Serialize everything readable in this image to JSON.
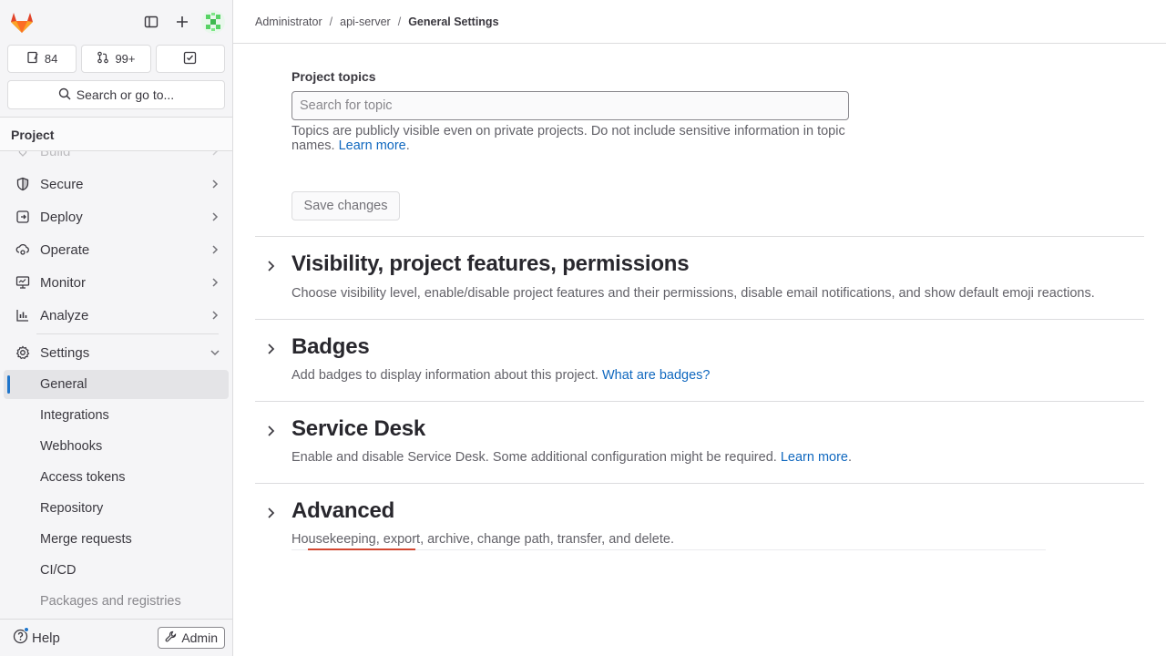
{
  "sidebar": {
    "counts": {
      "issues": "84",
      "merge_requests": "99+"
    },
    "search_label": "Search or go to...",
    "context_label": "Project",
    "nav": [
      {
        "label": "Build",
        "icon": "rocket-icon"
      },
      {
        "label": "Secure",
        "icon": "shield-icon"
      },
      {
        "label": "Deploy",
        "icon": "deploy-icon"
      },
      {
        "label": "Operate",
        "icon": "cloud-gear-icon"
      },
      {
        "label": "Monitor",
        "icon": "monitor-icon"
      },
      {
        "label": "Analyze",
        "icon": "chart-icon"
      },
      {
        "label": "Settings",
        "icon": "gear-icon"
      }
    ],
    "settings_items": [
      "General",
      "Integrations",
      "Webhooks",
      "Access tokens",
      "Repository",
      "Merge requests",
      "CI/CD",
      "Packages and registries"
    ],
    "help_label": "Help",
    "admin_label": "Admin"
  },
  "breadcrumb": {
    "items": [
      "Administrator",
      "api-server"
    ],
    "current": "General Settings"
  },
  "topics": {
    "label": "Project topics",
    "placeholder": "Search for topic",
    "help": "Topics are publicly visible even on private projects. Do not include sensitive information in topic names.",
    "help_link": "Learn more",
    "save_label": "Save changes"
  },
  "sections": [
    {
      "title": "Visibility, project features, permissions",
      "desc": "Choose visibility level, enable/disable project features and their permissions, disable email notifications, and show default emoji reactions.",
      "link": ""
    },
    {
      "title": "Badges",
      "desc": "Add badges to display information about this project.",
      "link": "What are badges?"
    },
    {
      "title": "Service Desk",
      "desc": "Enable and disable Service Desk. Some additional configuration might be required.",
      "link": "Learn more"
    },
    {
      "title": "Advanced",
      "desc": "Housekeeping, export, archive, change path, transfer, and delete.",
      "link": ""
    }
  ],
  "colors": {
    "accent": "#1f75cb",
    "link": "#1068bf",
    "logo": "#e24329"
  }
}
